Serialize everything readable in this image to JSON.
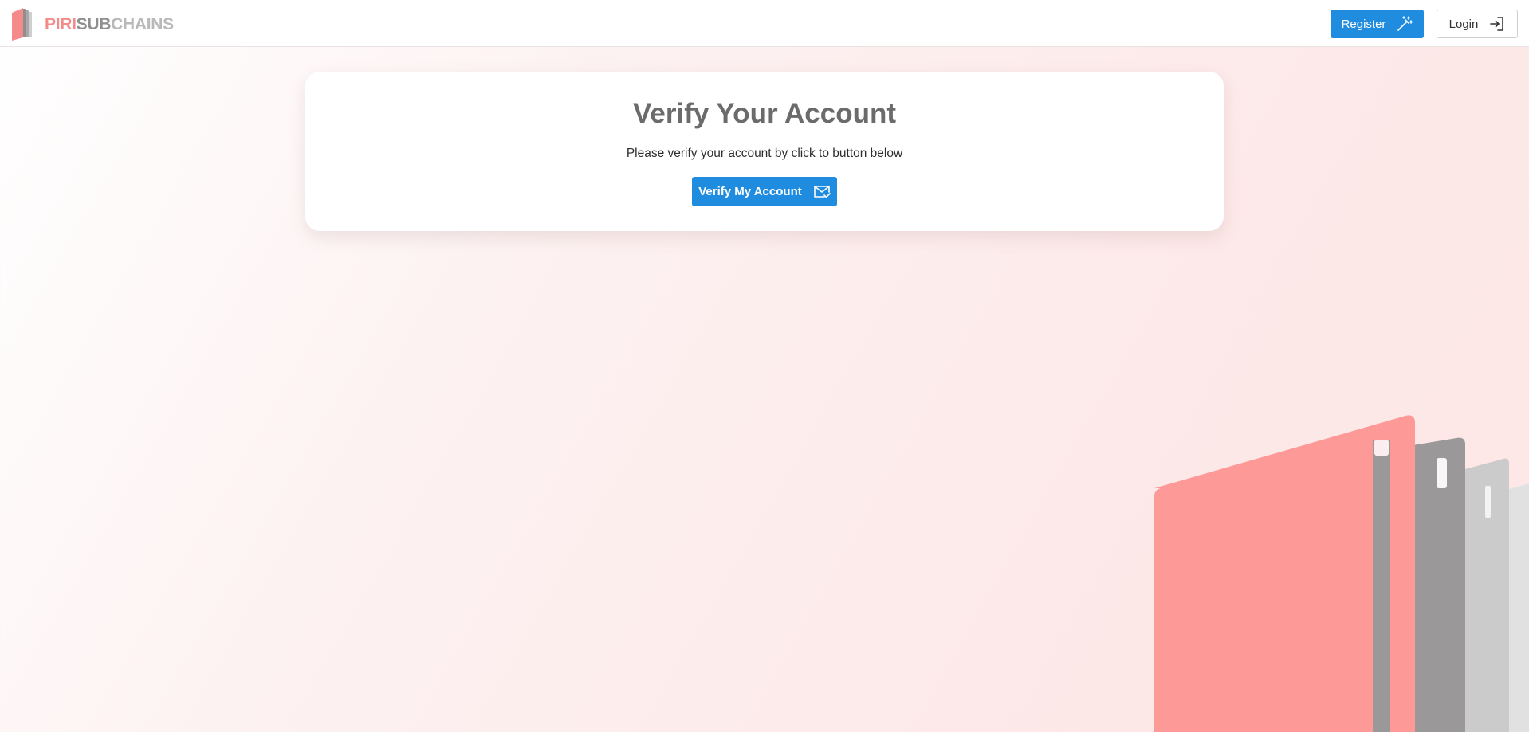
{
  "brand": {
    "part1": "PIRI",
    "part2": "SUB",
    "part3": "CHAINS",
    "logo_icon": "book-stack-logo-icon"
  },
  "nav": {
    "register_label": "Register",
    "register_icon": "magic-wand-icon",
    "login_label": "Login",
    "login_icon": "sign-in-icon"
  },
  "card": {
    "title": "Verify Your Account",
    "text": "Please verify your account by click to button below",
    "button_label": "Verify My Account",
    "button_icon": "envelope-check-icon"
  },
  "colors": {
    "primary": "#1f8ce0",
    "brand_pink": "#f48a8a",
    "brand_gray": "#8f8f8f",
    "title_gray": "#6c6b6b",
    "decor_pink": "#fd9a98"
  }
}
